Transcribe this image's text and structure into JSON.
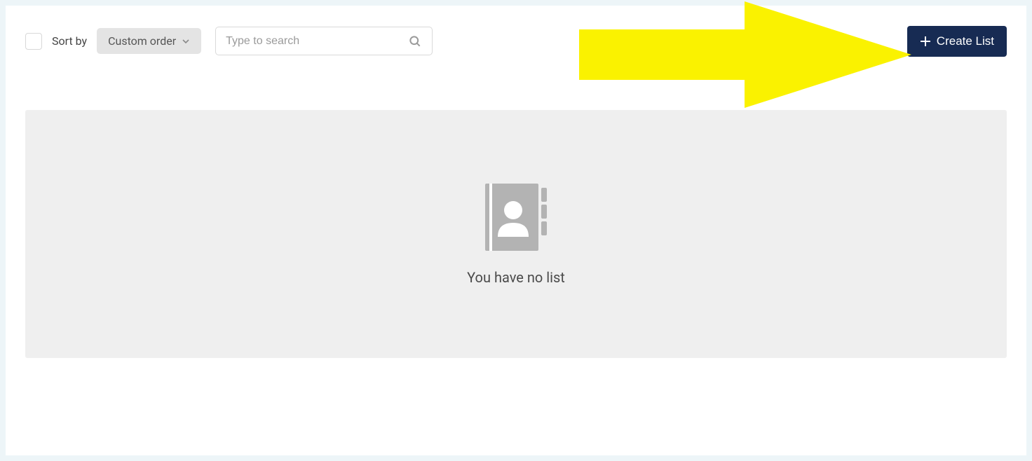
{
  "toolbar": {
    "sortby_label": "Sort by",
    "sort_selected": "Custom order",
    "search_placeholder": "Type to search",
    "create_label": "Create List"
  },
  "empty_state": {
    "message": "You have no list"
  }
}
